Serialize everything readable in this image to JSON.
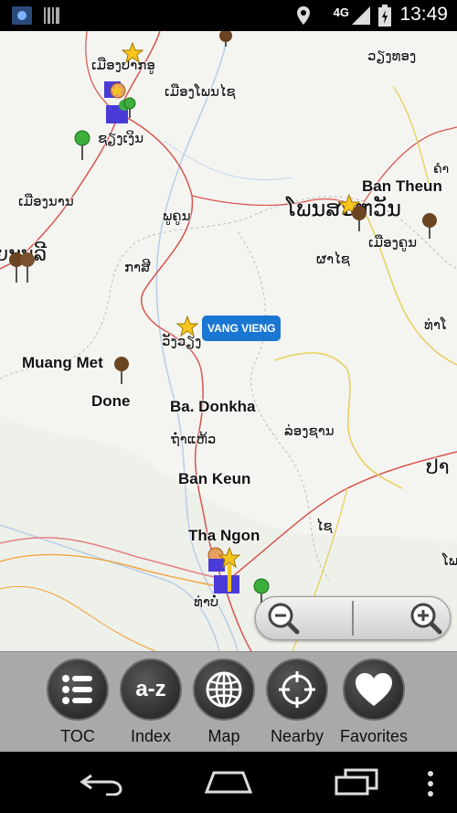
{
  "status_bar": {
    "time": "13:49",
    "network": "4G"
  },
  "map": {
    "labels": [
      "ເມືອງປາກອູ",
      "ເມືອງໂພນໄຊ",
      "ວຽງທອງ",
      "ຊຽງເງິນ",
      "ຄຳ",
      "Ban Theun",
      "ເມືອງນານ",
      "ພູຄູນ",
      "ໂພນສະຫວັນ",
      "ຍະບູລີ",
      "ເມືອງຄູນ",
      "ກາສີ",
      "ຜາໄຊ",
      "ທ່າໂ",
      "ວັງວຽງ",
      "Muang Met",
      "Done",
      "Ba. Donkha",
      "ຖໍ່າແຫ້ວ",
      "ລ່ອງຊານ",
      "ປາ",
      "Ban Keun",
      "ໄຊ",
      "Tha Ngon",
      "ທ່າບໍ່",
      "ໂພ"
    ],
    "highlight_badge": "VANG VIENG"
  },
  "zoom": {
    "zoom_out": "zoom-out",
    "zoom_in": "zoom-in"
  },
  "toolbar": [
    {
      "label": "TOC",
      "icon": "list-icon"
    },
    {
      "label": "Index",
      "icon": "a-z-icon"
    },
    {
      "label": "Map",
      "icon": "globe-icon"
    },
    {
      "label": "Nearby",
      "icon": "crosshair-icon"
    },
    {
      "label": "Favorites",
      "icon": "heart-icon"
    }
  ],
  "toolbar_az_text": "a-z",
  "colors": {
    "road_red": "#d9534f",
    "road_orange": "#f0a030",
    "road_yellow": "#e8cf5a",
    "badge_blue": "#1976d2",
    "toolbar_bg": "#a9a9a9"
  }
}
